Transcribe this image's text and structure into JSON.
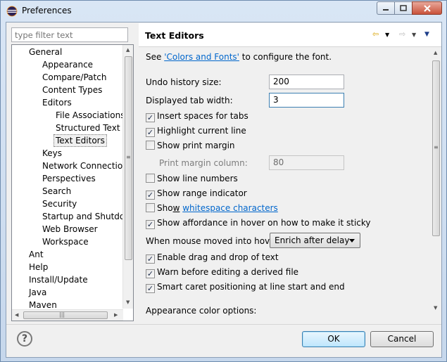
{
  "window": {
    "title": "Preferences"
  },
  "filter": {
    "placeholder": "type filter text"
  },
  "tree": {
    "items": [
      {
        "label": "General",
        "indent": 1
      },
      {
        "label": "Appearance",
        "indent": 2
      },
      {
        "label": "Compare/Patch",
        "indent": 2
      },
      {
        "label": "Content Types",
        "indent": 2
      },
      {
        "label": "Editors",
        "indent": 2
      },
      {
        "label": "File Associations",
        "indent": 3
      },
      {
        "label": "Structured Text E",
        "indent": 3
      },
      {
        "label": "Text Editors",
        "indent": 3,
        "selected": true
      },
      {
        "label": "Keys",
        "indent": 2
      },
      {
        "label": "Network Connectio",
        "indent": 2
      },
      {
        "label": "Perspectives",
        "indent": 2
      },
      {
        "label": "Search",
        "indent": 2
      },
      {
        "label": "Security",
        "indent": 2
      },
      {
        "label": "Startup and Shutdo",
        "indent": 2
      },
      {
        "label": "Web Browser",
        "indent": 2
      },
      {
        "label": "Workspace",
        "indent": 2
      },
      {
        "label": "Ant",
        "indent": 1
      },
      {
        "label": "Help",
        "indent": 1
      },
      {
        "label": "Install/Update",
        "indent": 1
      },
      {
        "label": "Java",
        "indent": 1
      },
      {
        "label": "Maven",
        "indent": 1
      }
    ]
  },
  "page": {
    "title": "Text Editors",
    "see_prefix": "See ",
    "see_link": "'Colors and Fonts'",
    "see_suffix": " to configure the font.",
    "undo_label": "Undo history size:",
    "undo_value": "200",
    "tab_label": "Displayed tab width:",
    "tab_value": "3",
    "insert_spaces": {
      "label": "Insert spaces for tabs",
      "checked": true
    },
    "highlight_line": {
      "label": "Highlight current line",
      "checked": true
    },
    "print_margin": {
      "label": "Show print margin",
      "checked": false
    },
    "print_margin_col_label": "Print margin column:",
    "print_margin_col_value": "80",
    "line_numbers": {
      "label": "Show line numbers",
      "checked": false
    },
    "range_indicator": {
      "label": "Show range indicator",
      "checked": true
    },
    "whitespace": {
      "label_prefix": "Sho",
      "label_mid": "w",
      "label_gap": " ",
      "link": "whitespace characters",
      "checked": false
    },
    "affordance": {
      "label": "Show affordance in hover on how to make it sticky",
      "checked": true
    },
    "hover_label": "When mouse moved into hover:",
    "hover_value": "Enrich after delay",
    "drag_drop": {
      "label": "Enable drag and drop of text",
      "checked": true
    },
    "warn_derived": {
      "label": "Warn before editing a derived file",
      "checked": true
    },
    "smart_caret": {
      "label": "Smart caret positioning at line start and end",
      "checked": true
    },
    "appearance_label": "Appearance color options:"
  },
  "buttons": {
    "ok": "OK",
    "cancel": "Cancel",
    "help": "?"
  }
}
